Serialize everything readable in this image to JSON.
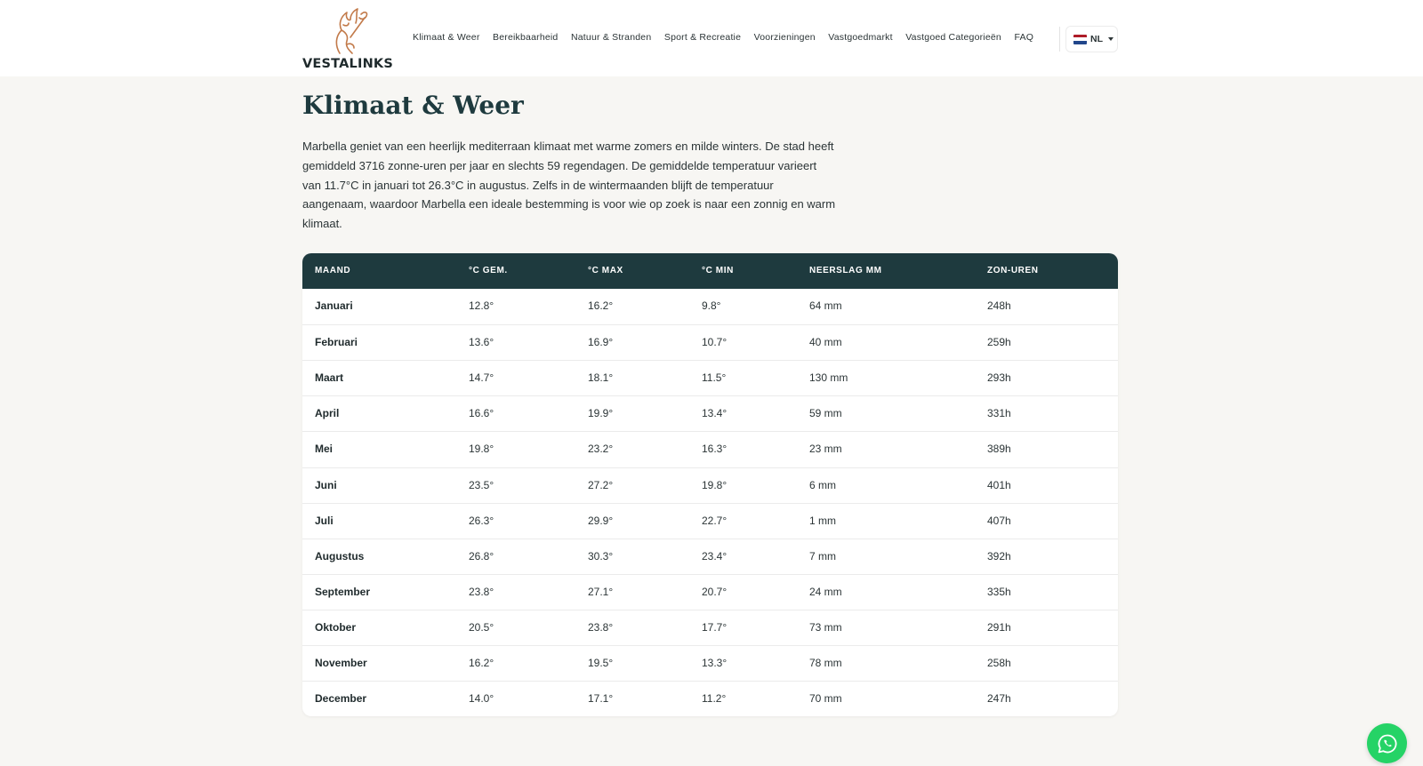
{
  "brand": {
    "name": "VESTALINKS",
    "accent": "#c27a4a"
  },
  "nav": {
    "items": [
      "Klimaat & Weer",
      "Bereikbaarheid",
      "Natuur & Stranden",
      "Sport & Recreatie",
      "Voorzieningen",
      "Vastgoedmarkt",
      "Vastgoed Categorieën",
      "FAQ"
    ],
    "lang": "NL"
  },
  "page": {
    "title": "Klimaat & Weer",
    "intro": "Marbella geniet van een heerlijk mediterraan klimaat met warme zomers en milde winters. De stad heeft gemiddeld 3716 zonne-uren per jaar en slechts 59 regendagen. De gemiddelde temperatuur varieert van 11.7°C in januari tot 26.3°C in augustus. Zelfs in de wintermaanden blijft de temperatuur aangenaam, waardoor Marbella een ideale bestemming is voor wie op zoek is naar een zonnig en warm klimaat."
  },
  "table": {
    "headers": [
      "MAAND",
      "°C GEM.",
      "°C MAX",
      "°C MIN",
      "NEERSLAG MM",
      "ZON-UREN"
    ],
    "rows": [
      [
        "Januari",
        "12.8°",
        "16.2°",
        "9.8°",
        "64 mm",
        "248h"
      ],
      [
        "Februari",
        "13.6°",
        "16.9°",
        "10.7°",
        "40 mm",
        "259h"
      ],
      [
        "Maart",
        "14.7°",
        "18.1°",
        "11.5°",
        "130 mm",
        "293h"
      ],
      [
        "April",
        "16.6°",
        "19.9°",
        "13.4°",
        "59 mm",
        "331h"
      ],
      [
        "Mei",
        "19.8°",
        "23.2°",
        "16.3°",
        "23 mm",
        "389h"
      ],
      [
        "Juni",
        "23.5°",
        "27.2°",
        "19.8°",
        "6 mm",
        "401h"
      ],
      [
        "Juli",
        "26.3°",
        "29.9°",
        "22.7°",
        "1 mm",
        "407h"
      ],
      [
        "Augustus",
        "26.8°",
        "30.3°",
        "23.4°",
        "7 mm",
        "392h"
      ],
      [
        "September",
        "23.8°",
        "27.1°",
        "20.7°",
        "24 mm",
        "335h"
      ],
      [
        "Oktober",
        "20.5°",
        "23.8°",
        "17.7°",
        "73 mm",
        "291h"
      ],
      [
        "November",
        "16.2°",
        "19.5°",
        "13.3°",
        "78 mm",
        "258h"
      ],
      [
        "December",
        "14.0°",
        "17.1°",
        "11.2°",
        "70 mm",
        "247h"
      ]
    ]
  },
  "colors": {
    "header_bg": "#1e3a3e",
    "page_bg": "#f7f6f3",
    "whatsapp": "#25d366"
  },
  "icons": {
    "logo": "vesta-flame-logo-icon",
    "flag": "netherlands-flag-icon",
    "caret": "chevron-down-icon",
    "whatsapp": "whatsapp-icon"
  }
}
